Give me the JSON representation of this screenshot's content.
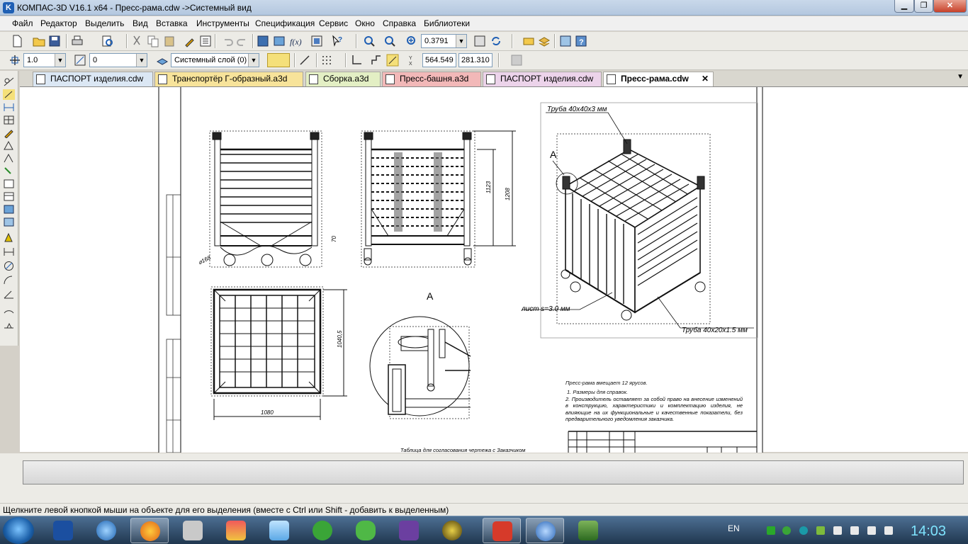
{
  "window": {
    "title": "КОМПАС-3D V16.1 x64 - Пресс-рама.cdw ->Системный вид"
  },
  "menu": [
    "Файл",
    "Редактор",
    "Выделить",
    "Вид",
    "Вставка",
    "Инструменты",
    "Спецификация",
    "Сервис",
    "Окно",
    "Справка",
    "Библиотеки"
  ],
  "toolbar1": {
    "zoom_value": "0.3791"
  },
  "toolbar2": {
    "line_step": "1.0",
    "angle_step": "0",
    "layer": "Системный слой (0)",
    "coord_x": "564.549",
    "coord_y": "281.310"
  },
  "tabs": [
    {
      "label": "ПАСПОРТ изделия.cdw",
      "color": "#dbe7f4"
    },
    {
      "label": "Транспортёр Г-образный.a3d",
      "color": "#f7e39a"
    },
    {
      "label": "Сборка.a3d",
      "color": "#e3efc4"
    },
    {
      "label": "Пресс-башня.a3d",
      "color": "#f2b8b8"
    },
    {
      "label": "ПАСПОРТ изделия.cdw",
      "color": "#ecd3ea"
    },
    {
      "label": "Пресс-рама.cdw",
      "color": "#ffffff",
      "close": "✕"
    }
  ],
  "drawing": {
    "label_pipe1": "Труба 40х40х3 мм",
    "label_pipe2": "Труба 40х20х1.5 мм",
    "label_sheet": "лист s=3.0 мм",
    "label_detail": "А",
    "detail_title": "А",
    "dim_width": "1080",
    "dim_h1": "1123",
    "dim_h2": "1208",
    "dim_side": "1040,5",
    "dim_wheel": "⌀168",
    "dim_small": "70",
    "notes_title": "Пресс-рама вмещает 12 ярусов.",
    "note1": "1. Размеры для справок.",
    "note2": "2. Производитель оставляет за собой право на внесение изменений в конструкцию, характеристики и комплектацию изделия, не влияющие на их функциональные и качественные показатели, без предварительного уведомления заказчика.",
    "bottom_text": "Таблица для согласования чертежа с Заказчиком"
  },
  "status": {
    "hint": "Щелкните левой кнопкой мыши на объекте для его выделения (вместе с Ctrl или Shift - добавить к выделенным)"
  },
  "taskbar": {
    "lang": "EN",
    "time": "14:03"
  }
}
